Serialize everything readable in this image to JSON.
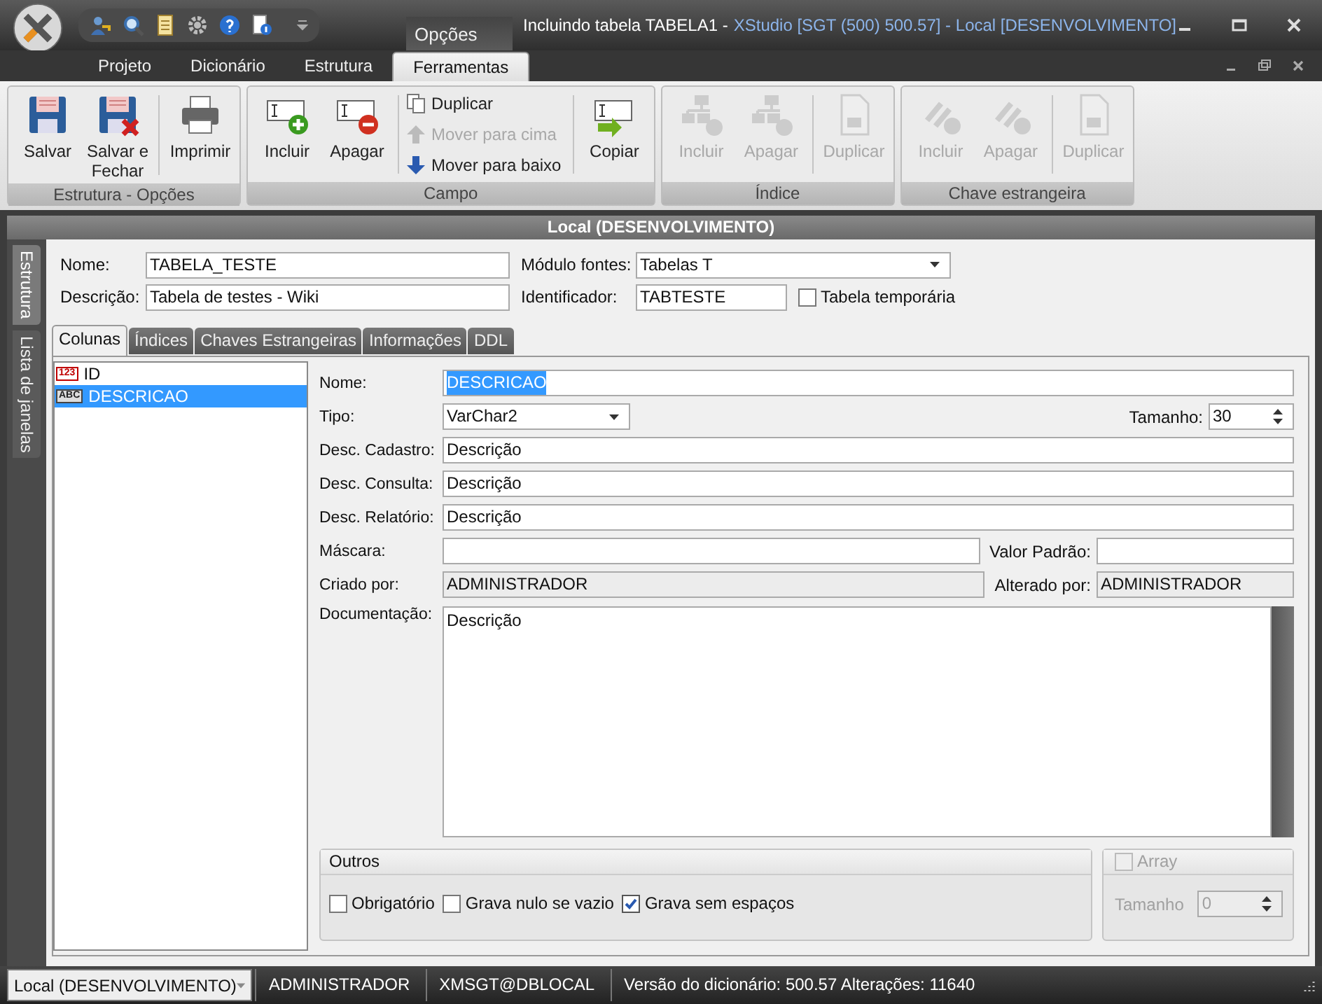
{
  "window": {
    "title": [
      {
        "text": "Incluindo tabela TABELA1 -",
        "kind": "document"
      },
      {
        "text": "XStudio [SGT (500) 500.57] - Local [DESENVOLVIMENTO]",
        "kind": "app"
      }
    ],
    "contextual_tab": "Opções"
  },
  "ribbon_tabs": [
    {
      "label": "Projeto",
      "selected": false
    },
    {
      "label": "Dicionário",
      "selected": false
    },
    {
      "label": "Estrutura",
      "selected": false
    },
    {
      "label": "Ferramentas",
      "selected": true
    }
  ],
  "ribbon_groups": [
    {
      "title": "Estrutura - Opções",
      "sections": [
        [
          {
            "label": "Salvar",
            "disabled": false
          }
        ],
        [
          {
            "label": "Salvar e Fechar",
            "disabled": false
          }
        ],
        [
          {
            "label": "Imprimir",
            "disabled": false
          }
        ]
      ]
    },
    {
      "title": "Campo",
      "sections": [
        [
          {
            "label": "Incluir",
            "disabled": false
          }
        ],
        [
          {
            "label": "Apagar",
            "disabled": false
          }
        ],
        [
          {
            "label": "Duplicar",
            "disabled": false
          },
          {
            "label": "Mover para cima",
            "disabled": true
          },
          {
            "label": "Mover para baixo",
            "disabled": false
          }
        ],
        [
          {
            "label": "Copiar",
            "disabled": false
          }
        ]
      ]
    },
    {
      "title": "Índice",
      "sections": [
        [
          {
            "label": "Incluir",
            "disabled": true
          }
        ],
        [
          {
            "label": "Apagar",
            "disabled": true
          }
        ],
        [
          {
            "label": "Duplicar",
            "disabled": true
          }
        ]
      ]
    },
    {
      "title": "Chave estrangeira",
      "sections": [
        [
          {
            "label": "Incluir",
            "disabled": true
          }
        ],
        [
          {
            "label": "Apagar",
            "disabled": true
          }
        ],
        [
          {
            "label": "Duplicar",
            "disabled": true
          }
        ]
      ]
    }
  ],
  "document": {
    "header": "Local (DESENVOLVIMENTO)"
  },
  "side_tabs": [
    {
      "label": "Estrutura",
      "selected": true
    },
    {
      "label": "Lista de janelas",
      "selected": false
    }
  ],
  "table_form": {
    "nome": {
      "label": "Nome:",
      "value": "TABELA_TESTE"
    },
    "descricao": {
      "label": "Descrição:",
      "value": "Tabela de testes - Wiki"
    },
    "modulo_fontes": {
      "label": "Módulo fontes:",
      "value": "Tabelas T"
    },
    "identificador": {
      "label": "Identificador:",
      "value": "TABTESTE"
    },
    "tabela_temporaria": {
      "label": "Tabela temporária",
      "checked": false
    }
  },
  "tabs": [
    {
      "label": "Colunas",
      "selected": true
    },
    {
      "label": "Índices",
      "selected": false
    },
    {
      "label": "Chaves Estrangeiras",
      "selected": false
    },
    {
      "label": "Informações",
      "selected": false
    },
    {
      "label": "DDL",
      "selected": false
    }
  ],
  "columns": [
    {
      "badge": "123",
      "kind": "number",
      "name": "ID",
      "selected": false
    },
    {
      "badge": "ABC",
      "kind": "text",
      "name": "DESCRICAO",
      "selected": true
    }
  ],
  "column_form": {
    "nome": {
      "label": "Nome:",
      "value": "DESCRICAO",
      "highlighted": true
    },
    "tipo": {
      "label": "Tipo:",
      "value": "VarChar2"
    },
    "tamanho": {
      "label": "Tamanho:",
      "value": "30"
    },
    "descriptions": [
      {
        "label": "Desc. Cadastro:",
        "value": "Descrição"
      },
      {
        "label": "Desc. Consulta:",
        "value": "Descrição"
      },
      {
        "label": "Desc. Relatório:",
        "value": "Descrição"
      }
    ],
    "mascara": {
      "label": "Máscara:"
    },
    "valor_padrao": {
      "label": "Valor Padrão:"
    },
    "criado_por": {
      "label": "Criado por:",
      "value": "ADMINISTRADOR",
      "readonly": true
    },
    "alterado_por": {
      "label": "Alterado por:",
      "value": "ADMINISTRADOR",
      "readonly": true
    },
    "documentacao": {
      "label": "Documentação:",
      "value": "Descrição"
    }
  },
  "outros": {
    "title": "Outros",
    "options": [
      {
        "label": "Obrigatório",
        "checked": false
      },
      {
        "label": "Grava nulo se vazio",
        "checked": false
      },
      {
        "label": "Grava sem espaços",
        "checked": true
      }
    ]
  },
  "array": {
    "label": "Array",
    "checked": false,
    "disabled": true,
    "size_label": "Tamanho",
    "size_value": "0"
  },
  "status_bar": {
    "connection": "Local (DESENVOLVIMENTO)",
    "user": "ADMINISTRADOR",
    "database": "XMSGT@DBLOCAL",
    "version": "Versão do dicionário: 500.57 Alterações: 11640"
  }
}
